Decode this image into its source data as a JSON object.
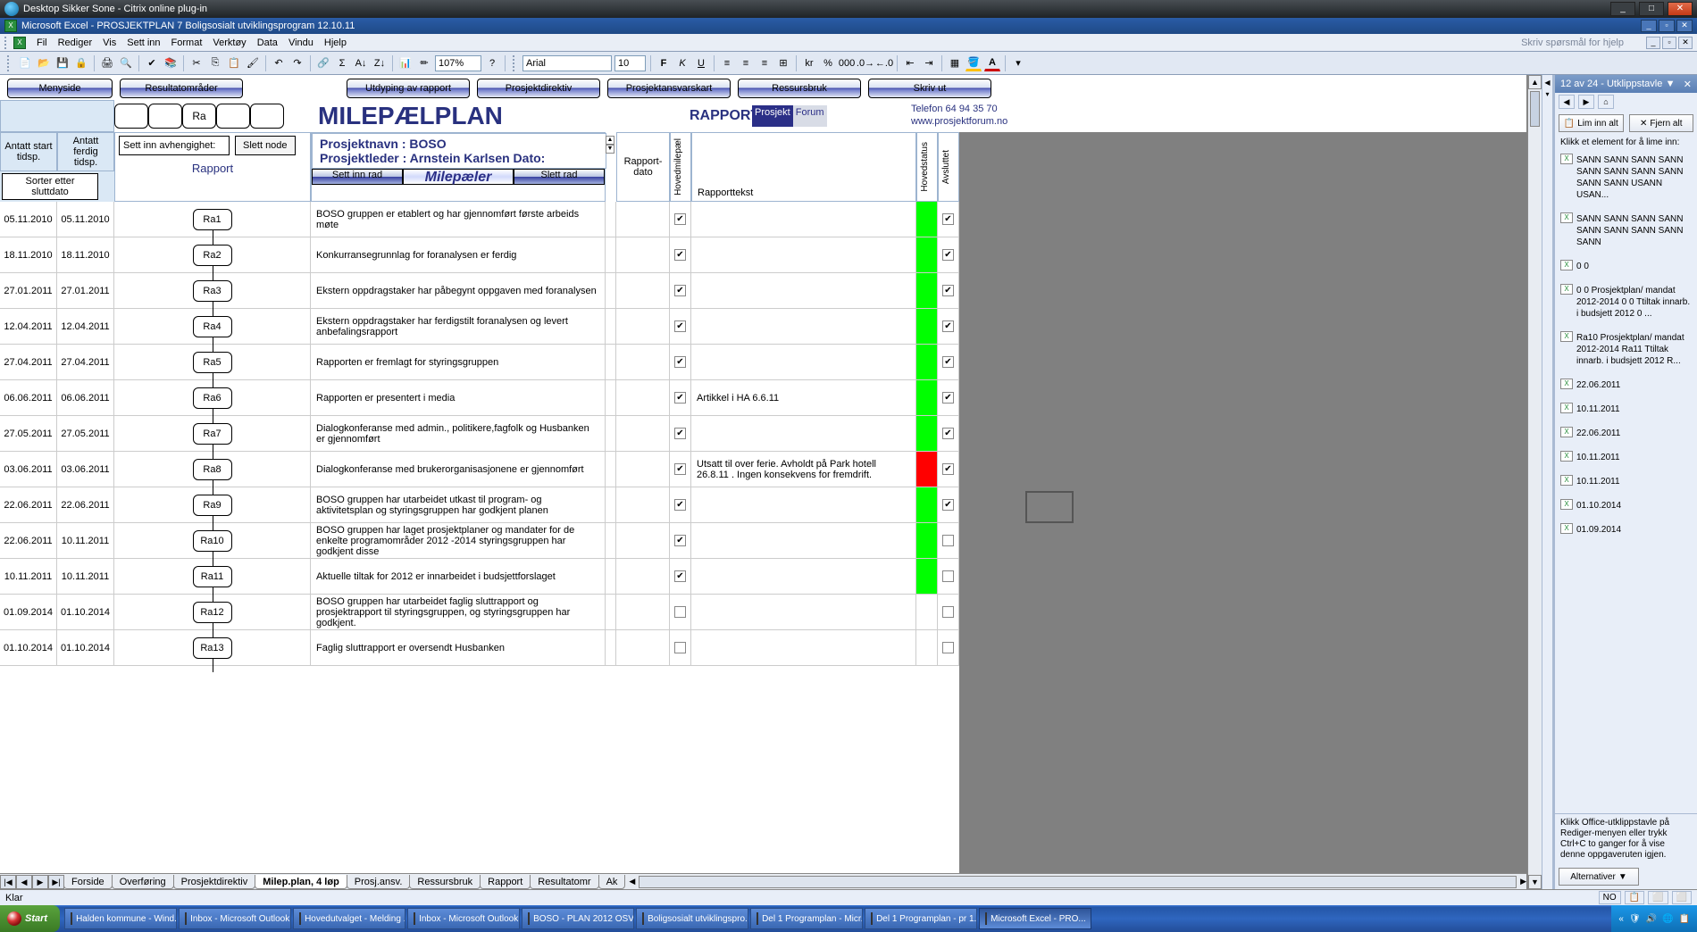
{
  "citrix": {
    "title": "Desktop Sikker Sone - Citrix online plug-in"
  },
  "excel_title": "Microsoft Excel - PROSJEKTPLAN 7 Boligsosialt utviklingsprogram 12.10.11",
  "menus": [
    "Fil",
    "Rediger",
    "Vis",
    "Sett inn",
    "Format",
    "Verktøy",
    "Data",
    "Vindu",
    "Hjelp"
  ],
  "ask_help": "Skriv spørsmål for hjelp",
  "zoom": "107%",
  "font_name": "Arial",
  "font_size": "10",
  "nav_buttons": [
    "Menyside",
    "Resultatområder",
    "Utdyping av rapport",
    "Prosjektdirektiv",
    "Prosjektansvarskart",
    "Ressursbruk",
    "Skriv ut"
  ],
  "header": {
    "empty_box_label": "Ra",
    "big_title": "MILEPÆLPLAN",
    "rapport": "RAPPORT",
    "tel": "Telefon   64 94 35 70",
    "web": "www.prosjektforum.no",
    "logo_p": "Prosjekt",
    "logo_f": "Forum"
  },
  "subheader": {
    "prosjektnavn": "Prosjektnavn : BOSO",
    "prosjektleder": "Prosjektleder : Arnstein Karlsen     Dato:"
  },
  "columns": {
    "antatt_start": "Antatt start tidsp.",
    "antatt_ferdig": "Antatt ferdig tidsp.",
    "rapport": "Rapport",
    "sorter": "Sorter etter sluttdato",
    "sett_inn_avh": "Sett inn avhengighet:",
    "slett_node": "Slett node",
    "sett_inn_rad": "Sett inn rad",
    "milepaeler": "Milepæler",
    "slett_rad": "Slett rad",
    "rapport_dato": "Rapport-dato",
    "hovedmilepael": "Hovedmilepæl",
    "rapporttekst": "Rapporttekst",
    "hovedstatus": "Hovedstatus",
    "avsluttet": "Avsluttet"
  },
  "rows": [
    {
      "start": "05.11.2010",
      "slutt": "05.11.2010",
      "node": "Ra1",
      "desc": "BOSO gruppen er etablert og har gjennomført første arbeids møte",
      "hmp": true,
      "rtext": "",
      "stat": "green",
      "avs": true
    },
    {
      "start": "18.11.2010",
      "slutt": "18.11.2010",
      "node": "Ra2",
      "desc": "Konkurransegrunnlag for foranalysen er ferdig",
      "hmp": true,
      "rtext": "",
      "stat": "green",
      "avs": true
    },
    {
      "start": "27.01.2011",
      "slutt": "27.01.2011",
      "node": "Ra3",
      "desc": "Ekstern oppdragstaker har påbegynt oppgaven med foranalysen",
      "hmp": true,
      "rtext": "",
      "stat": "green",
      "avs": true
    },
    {
      "start": "12.04.2011",
      "slutt": "12.04.2011",
      "node": "Ra4",
      "desc": "Ekstern oppdragstaker har ferdigstilt foranalysen og levert anbefalingsrapport",
      "hmp": true,
      "rtext": "",
      "stat": "green",
      "avs": true
    },
    {
      "start": "27.04.2011",
      "slutt": "27.04.2011",
      "node": "Ra5",
      "desc": "Rapporten er fremlagt for styringsgruppen",
      "hmp": true,
      "rtext": "",
      "stat": "green",
      "avs": true
    },
    {
      "start": "06.06.2011",
      "slutt": "06.06.2011",
      "node": "Ra6",
      "desc": "Rapporten er presentert i media",
      "hmp": true,
      "rtext": "Artikkel i HA 6.6.11",
      "stat": "green",
      "avs": true
    },
    {
      "start": "27.05.2011",
      "slutt": "27.05.2011",
      "node": "Ra7",
      "desc": "Dialogkonferanse med admin., politikere,fagfolk og Husbanken er gjennomført",
      "hmp": true,
      "rtext": "",
      "stat": "green",
      "avs": true
    },
    {
      "start": "03.06.2011",
      "slutt": "03.06.2011",
      "node": "Ra8",
      "desc": "Dialogkonferanse med brukerorganisasjonene er gjennomført",
      "hmp": true,
      "rtext": "Utsatt til over ferie. Avholdt på Park hotell 26.8.11 . Ingen konsekvens for fremdrift.",
      "stat": "red",
      "avs": true
    },
    {
      "start": "22.06.2011",
      "slutt": "22.06.2011",
      "node": "Ra9",
      "desc": "BOSO gruppen har utarbeidet utkast til program- og aktivitetsplan og styringsgruppen har godkjent planen",
      "hmp": true,
      "rtext": "",
      "stat": "green",
      "avs": true
    },
    {
      "start": "22.06.2011",
      "slutt": "10.11.2011",
      "node": "Ra10",
      "desc": "BOSO gruppen har laget prosjektplaner og mandater for de enkelte  programområder 2012 -2014  styringsgruppen har godkjent disse",
      "hmp": true,
      "rtext": "",
      "stat": "green",
      "avs": false
    },
    {
      "start": "10.11.2011",
      "slutt": "10.11.2011",
      "node": "Ra11",
      "desc": "Aktuelle tiltak for 2012 er innarbeidet i budsjettforslaget",
      "hmp": true,
      "rtext": "",
      "stat": "green",
      "avs": false
    },
    {
      "start": "01.09.2014",
      "slutt": "01.10.2014",
      "node": "Ra12",
      "desc": "BOSO gruppen har utarbeidet faglig sluttrapport og prosjektrapport til styringsgruppen, og styringsgruppen har godkjent.",
      "hmp": false,
      "rtext": "",
      "stat": "",
      "avs": false
    },
    {
      "start": "01.10.2014",
      "slutt": "01.10.2014",
      "node": "Ra13",
      "desc": "Faglig sluttrapport er oversendt Husbanken",
      "hmp": false,
      "rtext": "",
      "stat": "",
      "avs": false
    }
  ],
  "sheet_tabs": [
    "Forside",
    "Overføring",
    "Prosjektdirektiv",
    "Milep.plan, 4 løp",
    "Prosj.ansv.",
    "Ressursbruk",
    "Rapport",
    "Resultatomr",
    "Ak"
  ],
  "sheet_active": 3,
  "status_bar": {
    "text": "Klar",
    "lang": "NO"
  },
  "task_pane": {
    "title": "12 av 24 - Utklippstavle",
    "paste_all": "Lim inn alt",
    "clear_all": "Fjern alt",
    "hint": "Klikk et element for å lime inn:",
    "items": [
      "SANN SANN SANN SANN SANN SANN SANN SANN SANN SANN USANN USAN...",
      "SANN SANN SANN SANN SANN SANN SANN SANN SANN",
      "0 0",
      "0 0 Prosjektplan/ mandat 2012-2014 0 0 Ttiltak innarb. i budsjett 2012 0 ...",
      "Ra10 Prosjektplan/ mandat 2012-2014 Ra11 Ttiltak innarb. i budsjett 2012 R...",
      "22.06.2011",
      "10.11.2011",
      "22.06.2011",
      "10.11.2011",
      "10.11.2011",
      "01.10.2014",
      "01.09.2014"
    ],
    "foot": "Klikk Office-utklippstavle på Rediger-menyen eller trykk Ctrl+C to ganger for å vise denne oppgaveruten igjen.",
    "options": "Alternativer"
  },
  "taskbar": {
    "start": "Start",
    "items": [
      "Halden kommune - Wind...",
      "Inbox - Microsoft Outlook",
      "Hovedutvalget - Melding ...",
      "Inbox - Microsoft Outlook",
      "BOSO - PLAN 2012 OSV...",
      "Boligsosialt utviklingspro...",
      "Del 1 Programplan - Micr...",
      "Del 1 Programplan - pr 1...",
      "Microsoft Excel - PRO..."
    ],
    "active": 8
  }
}
